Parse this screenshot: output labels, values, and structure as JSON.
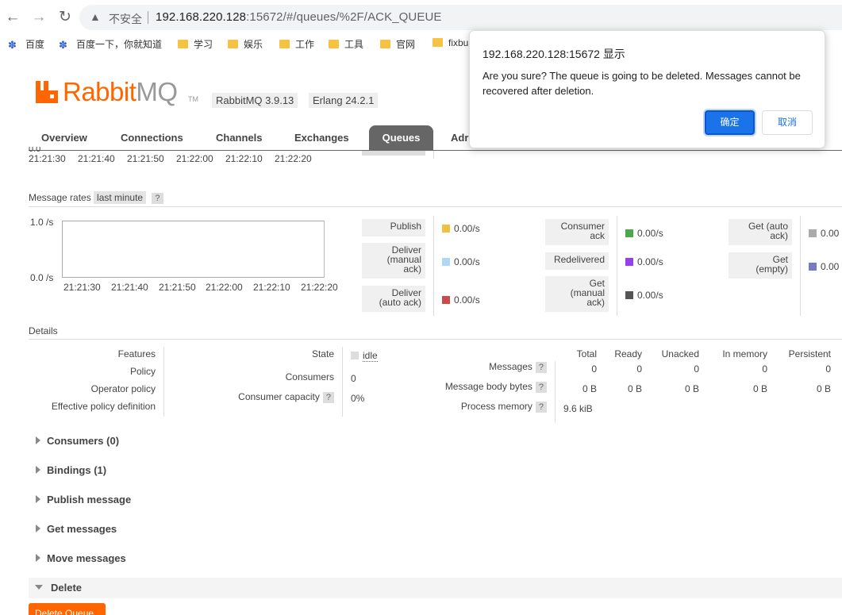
{
  "browser": {
    "insecure_label": "不安全",
    "url_host": "192.168.220.128",
    "url_rest": ":15672/#/queues/%2F/ACK_QUEUE",
    "bookmarks": [
      "百度",
      "百度一下，你就知道",
      "学习",
      "娱乐",
      "工作",
      "工具",
      "官网",
      "fixbu"
    ]
  },
  "app": {
    "logo_rabbit": "Rabbit",
    "logo_mq": "MQ",
    "logo_tm": "TM",
    "rabbitmq_version": "RabbitMQ 3.9.13",
    "erlang_version": "Erlang 24.2.1",
    "tabs": [
      "Overview",
      "Connections",
      "Channels",
      "Exchanges",
      "Queues",
      "Adr"
    ],
    "active_tab": "Queues"
  },
  "top_chart": {
    "cut_label": "0.0",
    "x_ticks": [
      "21:21:30",
      "21:21:40",
      "21:21:50",
      "21:22:00",
      "21:22:10",
      "21:22:20"
    ]
  },
  "message_rates": {
    "title": "Message rates",
    "period": "last minute",
    "help": "?",
    "y_max": "1.0 /s",
    "y_min": "0.0 /s",
    "x_ticks": [
      "21:21:30",
      "21:21:40",
      "21:21:50",
      "21:22:00",
      "21:22:10",
      "21:22:20"
    ],
    "col1": [
      {
        "label": "Publish",
        "value": "0.00/s",
        "color": "#edc240"
      },
      {
        "label": "Deliver\n(manual\nack)",
        "value": "0.00/s",
        "color": "#afd8f8"
      },
      {
        "label": "Deliver\n(auto ack)",
        "value": "0.00/s",
        "color": "#cb4b4b"
      }
    ],
    "col2": [
      {
        "label": "Consumer\nack",
        "value": "0.00/s",
        "color": "#4da74d"
      },
      {
        "label": "Redelivered",
        "value": "0.00/s",
        "color": "#9440ed"
      },
      {
        "label": "Get\n(manual\nack)",
        "value": "0.00/s",
        "color": "#555555"
      }
    ],
    "col3": [
      {
        "label": "Get (auto\nack)",
        "value": "0.00",
        "color": "#aaaaaa"
      },
      {
        "label": "Get\n(empty)",
        "value": "0.00",
        "color": "#7c79c3"
      }
    ]
  },
  "details": {
    "title": "Details",
    "labels": [
      "Features",
      "Policy",
      "Operator policy",
      "Effective policy definition"
    ],
    "state_label": "State",
    "state_value": "idle",
    "consumers_label": "Consumers",
    "consumers_value": "0",
    "capacity_label": "Consumer capacity",
    "capacity_value": "0%",
    "help": "?",
    "columns": [
      "Total",
      "Ready",
      "Unacked",
      "In memory",
      "Persistent"
    ],
    "messages_label": "Messages",
    "messages": [
      "0",
      "0",
      "0",
      "0",
      "0"
    ],
    "body_label": "Message body bytes",
    "body": [
      "0 B",
      "0 B",
      "0 B",
      "0 B",
      "0 B"
    ],
    "process_label": "Process memory",
    "process_value": "9.6 kiB"
  },
  "sections": [
    "Consumers (0)",
    "Bindings (1)",
    "Publish message",
    "Get messages",
    "Move messages",
    "Delete"
  ],
  "delete_button": "Delete Queue",
  "dialog": {
    "title": "192.168.220.128:15672 显示",
    "message": "Are you sure? The queue is going to be deleted. Messages cannot be recovered after deletion.",
    "ok": "确定",
    "cancel": "取消"
  }
}
